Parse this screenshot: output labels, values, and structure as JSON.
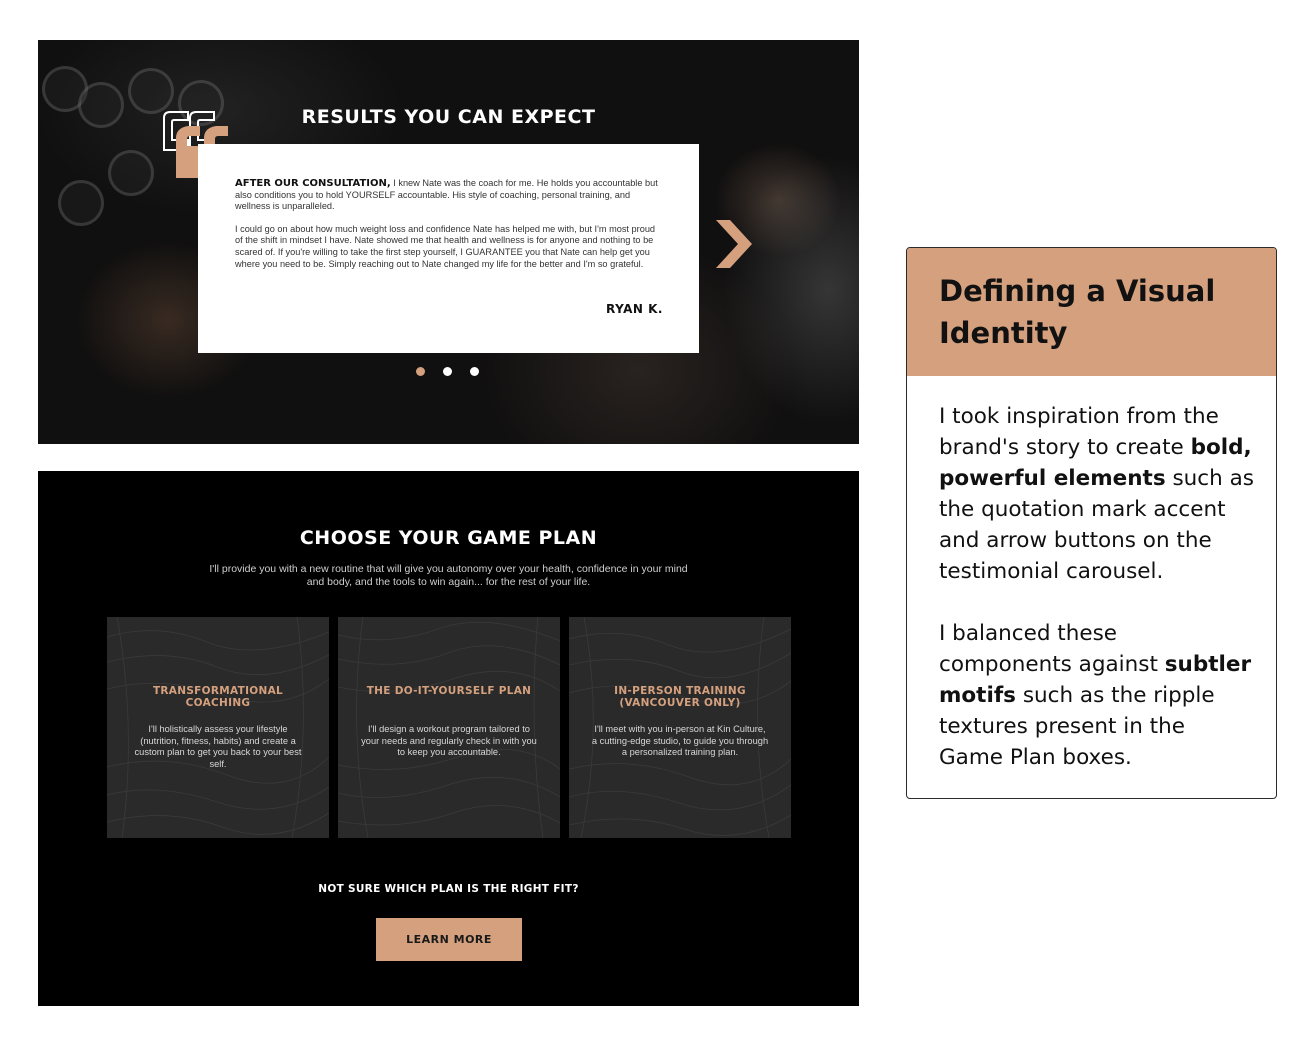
{
  "testimonial": {
    "title": "RESULTS YOU CAN EXPECT",
    "lead_bold": "AFTER OUR CONSULTATION,",
    "para1_rest": " I knew Nate was the coach for me. He holds you accountable but also conditions you to hold YOURSELF accountable. His style of coaching, personal training, and wellness is unparalleled.",
    "para2": "I could go on about how much weight loss and confidence Nate has helped me with, but I'm most proud of the shift in mindset I have. Nate showed me that health and wellness is for anyone and nothing to be scared of. If you're willing to take the first step yourself, I GUARANTEE you that Nate can help get you where you need to be. Simply reaching out to Nate changed my life for the better and I'm so grateful.",
    "author": "RYAN K.",
    "active_slide": 1,
    "slide_count": 3,
    "icons": {
      "quote": "quotation-mark-icon",
      "next": "chevron-right-icon"
    }
  },
  "game_plan": {
    "title": "CHOOSE YOUR GAME PLAN",
    "subtitle": "I'll provide you with a new routine that will give you autonomy over your health, confidence in your mind and body, and the tools to win again... for the rest of your life.",
    "plans": [
      {
        "title": "TRANSFORMATIONAL COACHING",
        "description": "I'll holistically assess your lifestyle (nutrition, fitness, habits) and create a custom plan to get you back to your best self."
      },
      {
        "title": "THE DO-IT-YOURSELF PLAN",
        "description": "I'll design a workout program tailored to your needs and regularly check in with you to keep you accountable."
      },
      {
        "title": "IN-PERSON TRAINING (VANCOUVER ONLY)",
        "description": "I'll meet with you in-person at Kin Culture, a cutting-edge studio, to guide you through a personalized training plan."
      }
    ],
    "question": "NOT SURE WHICH PLAN IS THE RIGHT FIT?",
    "button_label": "LEARN MORE"
  },
  "info_card": {
    "title": "Defining a Visual Identity",
    "p1_before": "I took inspiration from the brand's story to create ",
    "p1_bold": "bold, powerful elements",
    "p1_after": " such as the quotation mark accent and arrow buttons on the testimonial carousel.",
    "p2_before": "I balanced these components against ",
    "p2_bold": "subtler motifs",
    "p2_after": " such as the ripple textures present in the Game Plan boxes."
  },
  "colors": {
    "accent": "#d4a07e",
    "dark": "#000000",
    "plan_box": "#2a2a2a",
    "white": "#ffffff"
  }
}
